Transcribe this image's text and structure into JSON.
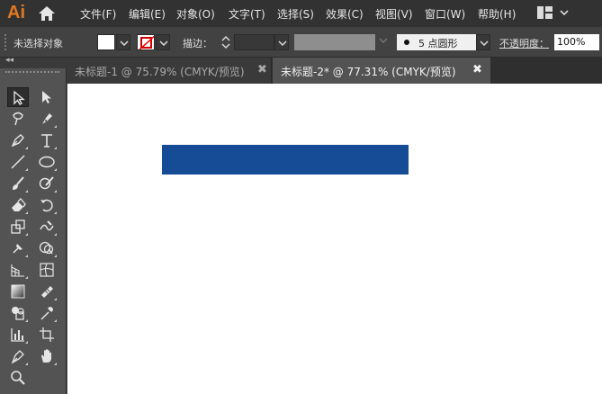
{
  "app": {
    "logo": "Ai"
  },
  "menu": [
    {
      "id": "file",
      "label": "文件(F)"
    },
    {
      "id": "edit",
      "label": "编辑(E)"
    },
    {
      "id": "object",
      "label": "对象(O)"
    },
    {
      "id": "type",
      "label": "文字(T)"
    },
    {
      "id": "select",
      "label": "选择(S)"
    },
    {
      "id": "effect",
      "label": "效果(C)"
    },
    {
      "id": "view",
      "label": "视图(V)"
    },
    {
      "id": "window",
      "label": "窗口(W)"
    },
    {
      "id": "help",
      "label": "帮助(H)"
    }
  ],
  "control": {
    "selection_label": "未选择对象",
    "stroke_label": "描边：",
    "brush_size": "5",
    "brush_name": "点圆形",
    "opacity_label": "不透明度：",
    "opacity_value": "100%"
  },
  "tabs": [
    {
      "title": "未标题-1 @ 75.79% (CMYK/预览)",
      "close": "✖",
      "active": false
    },
    {
      "title": "未标题-2* @ 77.31% (CMYK/预览)",
      "close": "✖",
      "active": true
    }
  ],
  "panel": {
    "collapse_glyph": "◂◂"
  },
  "colors": {
    "accent_logo": "#e2791f",
    "rectangle_fill": "#164c96",
    "canvas": "#ffffff"
  },
  "tools": [
    "selection-tool-icon",
    "direct-selection-tool-icon",
    "magic-wand-tool-icon",
    "lasso-tool-icon",
    "pen-tool-icon",
    "type-tool-icon",
    "line-segment-tool-icon",
    "ellipse-tool-icon",
    "paintbrush-tool-icon",
    "blob-brush-tool-icon",
    "eraser-tool-icon",
    "rotate-tool-icon",
    "scale-tool-icon",
    "warp-tool-icon",
    "puppet-warp-tool-icon",
    "shape-builder-tool-icon",
    "perspective-grid-tool-icon",
    "mesh-tool-icon",
    "gradient-tool-icon",
    "slice-tool-icon",
    "live-paint-bucket-icon",
    "eyedropper-tool-icon",
    "column-graph-tool-icon",
    "artboard-tool-icon",
    "slice-select-tool-icon",
    "hand-tool-icon",
    "zoom-tool-icon"
  ]
}
